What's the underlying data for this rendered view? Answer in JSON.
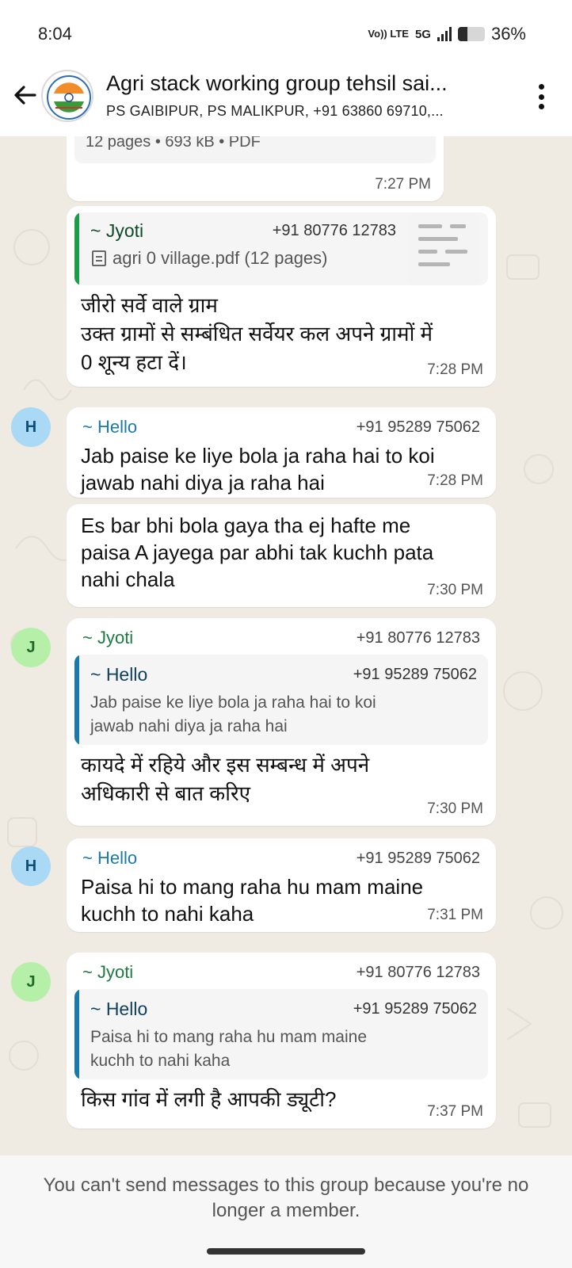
{
  "status_bar": {
    "time": "8:04",
    "network_label": "Vo)) LTE",
    "network_type": "5G",
    "battery_percent": "36%",
    "battery_level": 0.36
  },
  "header": {
    "title": "Agri stack working group tehsil sai...",
    "subtitle": "PS GAIBIPUR, PS MALIKPUR, +91 63860 69710,...",
    "back_icon": "arrow-left-icon",
    "menu_icon": "more-vertical-icon"
  },
  "messages": {
    "m0": {
      "doc_info": "12 pages • 693 kB • PDF",
      "time": "7:27 PM"
    },
    "m1": {
      "quote": {
        "sender": "~ Jyoti",
        "phone": "+91 80776 12783",
        "doc_name": "agri 0 village.pdf (12 pages)"
      },
      "lines": [
        "जीरो सर्वे वाले ग्राम",
        "उक्त ग्रामों से सम्बंधित सर्वेयर कल अपने ग्रामों में",
        "0 शून्य हटा दें।"
      ],
      "time": "7:28 PM"
    },
    "m2": {
      "avatar": "H",
      "sender": "~ Hello",
      "phone": "+91 95289 75062",
      "lines": [
        "Jab paise ke liye bola ja raha hai to koi",
        "jawab nahi diya ja raha hai"
      ],
      "time": "7:28 PM"
    },
    "m3": {
      "lines": [
        "Es bar bhi bola gaya tha ej hafte me",
        "paisa A jayega par abhi tak kuchh pata",
        "nahi chala"
      ],
      "time": "7:30 PM"
    },
    "m4": {
      "avatar": "J",
      "sender": "~ Jyoti",
      "phone": "+91 80776 12783",
      "quote": {
        "sender": "~ Hello",
        "phone": "+91 95289 75062",
        "lines": [
          "Jab paise ke liye bola ja raha hai to koi",
          "jawab nahi diya ja raha hai"
        ]
      },
      "lines": [
        "कायदे में रहिये और इस सम्बन्ध में अपने",
        "अधिकारी से बात करिए"
      ],
      "time": "7:30 PM"
    },
    "m5": {
      "avatar": "H",
      "sender": "~ Hello",
      "phone": "+91 95289 75062",
      "lines": [
        "Paisa hi to mang raha hu mam maine",
        "kuchh to nahi kaha"
      ],
      "time": "7:31 PM"
    },
    "m6": {
      "avatar": "J",
      "sender": "~ Jyoti",
      "phone": "+91 80776 12783",
      "quote": {
        "sender": "~ Hello",
        "phone": "+91 95289 75062",
        "lines": [
          "Paisa hi to mang raha hu mam maine",
          "kuchh to nahi kaha"
        ]
      },
      "lines": [
        "किस गांव में लगी है आपकी ड्यूटी?"
      ],
      "time": "7:37 PM"
    }
  },
  "footer": {
    "notice": "You can't send messages to this group because you're no longer a member."
  }
}
